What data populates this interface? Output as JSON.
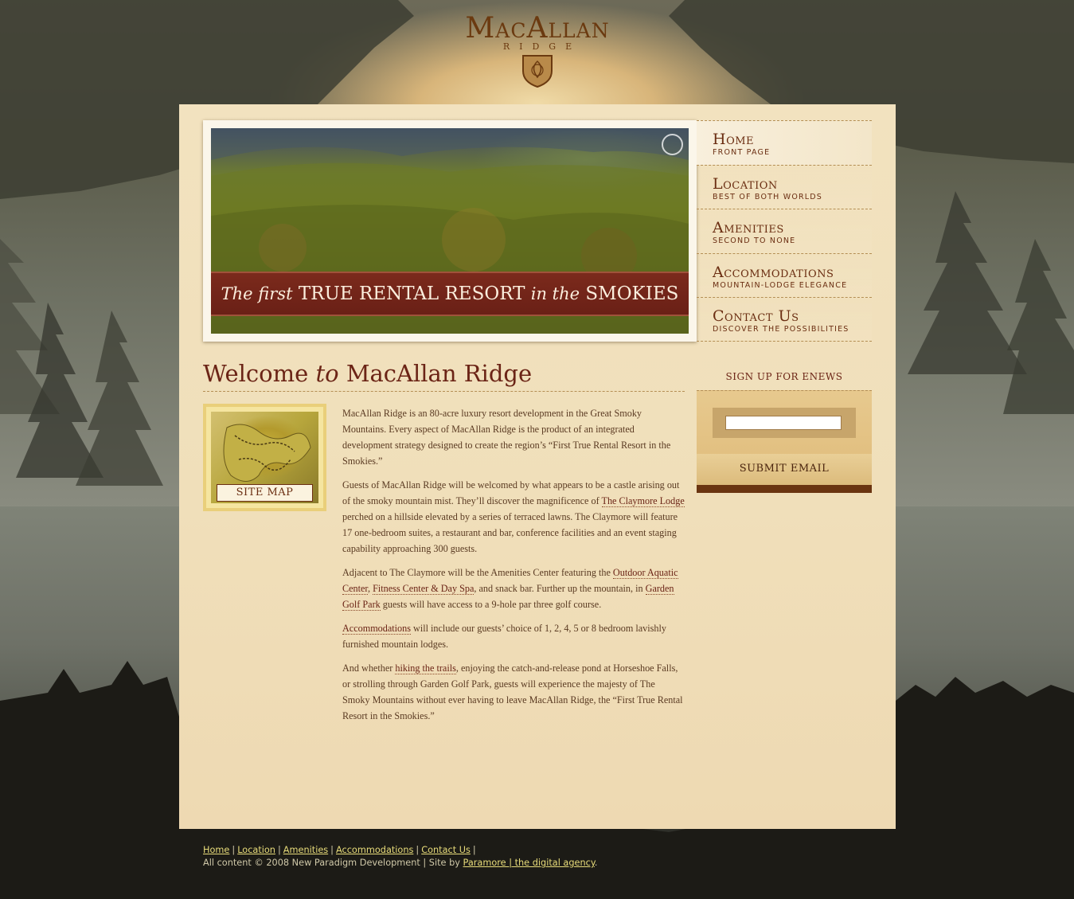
{
  "logo": {
    "title": "MacAllan",
    "subtitle": "RIDGE"
  },
  "hero": {
    "tagline_the_first": "The first",
    "tagline_main": "TRUE RENTAL RESORT",
    "tagline_in_the": "in the",
    "tagline_end": "SMOKIES"
  },
  "nav": {
    "items": [
      {
        "title": "Home",
        "subtitle": "Front Page"
      },
      {
        "title": "Location",
        "subtitle": "Best of Both Worlds"
      },
      {
        "title": "Amenities",
        "subtitle": "Second to None"
      },
      {
        "title": "Accommodations",
        "subtitle": "Mountain-Lodge Elegance"
      },
      {
        "title": "Contact Us",
        "subtitle": "Discover the Possibilities"
      }
    ]
  },
  "welcome": {
    "title_welcome": "Welcome",
    "title_to": "to",
    "title_name": "MacAllan Ridge"
  },
  "sitemap": {
    "label": "Site Map"
  },
  "copy": {
    "p1": "MacAllan Ridge is an 80-acre luxury resort development in the Great Smoky Mountains. Every aspect of MacAllan Ridge is the product of an integrated development strategy designed to create the region’s “First True Rental Resort in the Smokies.”",
    "p2_a": "Guests of MacAllan Ridge will be welcomed by what appears to be a castle arising out of the smoky mountain mist. They’ll discover the magnificence of ",
    "p2_link": "The Claymore Lodge",
    "p2_b": " perched on a hillside elevated by a series of terraced lawns. The Claymore will feature 17 one-bedroom suites, a restaurant and bar, conference facilities and an event staging capability approaching 300 guests.",
    "p3_a": "Adjacent to The Claymore will be the Amenities Center featuring the ",
    "p3_link1": "Outdoor Aquatic Center",
    "p3_comma": ", ",
    "p3_link2": "Fitness Center & Day Spa",
    "p3_b": ", and snack bar. Further up the mountain, in ",
    "p3_link3": "Garden Golf Park",
    "p3_c": " guests will have access to a 9-hole par three golf course.",
    "p4_link": "Accommodations",
    "p4_b": " will include our guests’ choice of 1, 2, 4, 5 or 8 bedroom lavishly furnished mountain lodges.",
    "p5_a": "And whether ",
    "p5_link": "hiking the trails",
    "p5_b": ", enjoying the catch-and-release pond at Horseshoe Falls, or strolling through Garden Golf Park, guests will experience the majesty of The Smoky Mountains without ever having to leave MacAllan Ridge, the “First True Rental Resort in the Smokies.”"
  },
  "enews": {
    "title": "Sign up for eNews",
    "input_value": "",
    "submit_label": "Submit Email"
  },
  "footer": {
    "links": [
      "Home",
      "Location",
      "Amenities",
      "Accommodations",
      "Contact Us"
    ],
    "sep": "|",
    "copyright": "All content © 2008 New Paradigm Development | Site by ",
    "agency_link": "Paramore | the digital agency",
    "period": "."
  },
  "colors": {
    "brand_brown": "#6b2e12",
    "banner_red": "#6a2016",
    "paper": "#f0dfba",
    "footer_link": "#e8dc7a"
  }
}
